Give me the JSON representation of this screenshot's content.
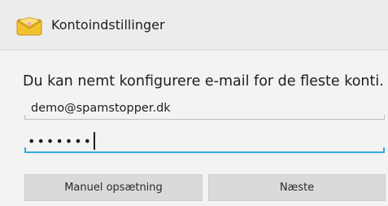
{
  "titlebar": {
    "title": "Kontoindstillinger",
    "icon": "email-envelope-icon",
    "icon_colors": {
      "envelope": "#f2c12e",
      "flap": "#ffe27a",
      "outline": "#c8921a"
    }
  },
  "form": {
    "intro": "Du kan nemt konfigurere e-mail for de fleste konti.",
    "email": {
      "value": "demo@spamstopper.dk",
      "placeholder": ""
    },
    "password": {
      "masked_value": "•••••••",
      "length": 7,
      "focused": true
    }
  },
  "buttons": {
    "manual_label": "Manuel opsætning",
    "next_label": "Næste"
  },
  "colors": {
    "focus_underline": "#33a9de",
    "idle_underline": "#bdbdbd",
    "button_bg": "#dadada"
  }
}
